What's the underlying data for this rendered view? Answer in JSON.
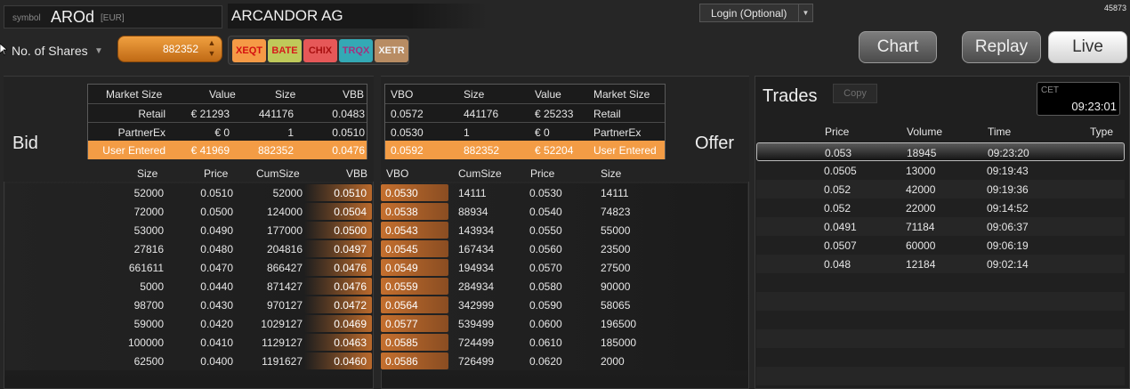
{
  "header": {
    "symbol_prefix": "symbol",
    "symbol": "AROd",
    "currency": "[EUR]",
    "company": "ARCANDOR AG",
    "login": "Login (Optional)",
    "build": "45873"
  },
  "controls": {
    "shares_label": "No. of Shares",
    "shares_value": "882352",
    "exchanges": [
      "XEQT",
      "BATE",
      "CHIX",
      "TRQX",
      "XETR"
    ],
    "chart": "Chart",
    "replay": "Replay",
    "live": "Live"
  },
  "bid": {
    "label": "Bid",
    "summary_headers": [
      "Market Size",
      "Value",
      "Size",
      "VBB"
    ],
    "summary": [
      {
        "market": "Retail",
        "value": "€ 21293",
        "size": "441176",
        "vbb": "0.0483"
      },
      {
        "market": "PartnerEx",
        "value": "€ 0",
        "size": "1",
        "vbb": "0.0510"
      },
      {
        "market": "User Entered",
        "value": "€ 41969",
        "size": "882352",
        "vbb": "0.0476"
      }
    ],
    "headers": [
      "Size",
      "Price",
      "CumSize",
      "VBB"
    ],
    "rows": [
      [
        "52000",
        "0.0510",
        "52000",
        "0.0510"
      ],
      [
        "72000",
        "0.0500",
        "124000",
        "0.0504"
      ],
      [
        "53000",
        "0.0490",
        "177000",
        "0.0500"
      ],
      [
        "27816",
        "0.0480",
        "204816",
        "0.0497"
      ],
      [
        "661611",
        "0.0470",
        "866427",
        "0.0476"
      ],
      [
        "5000",
        "0.0440",
        "871427",
        "0.0476"
      ],
      [
        "98700",
        "0.0430",
        "970127",
        "0.0472"
      ],
      [
        "59000",
        "0.0420",
        "1029127",
        "0.0469"
      ],
      [
        "100000",
        "0.0410",
        "1129127",
        "0.0463"
      ],
      [
        "62500",
        "0.0400",
        "1191627",
        "0.0460"
      ]
    ]
  },
  "offer": {
    "label": "Offer",
    "summary_headers": [
      "VBO",
      "Size",
      "Value",
      "Market Size"
    ],
    "summary": [
      {
        "vbo": "0.0572",
        "size": "441176",
        "value": "€ 25233",
        "market": "Retail"
      },
      {
        "vbo": "0.0530",
        "size": "1",
        "value": "€ 0",
        "market": "PartnerEx"
      },
      {
        "vbo": "0.0592",
        "size": "882352",
        "value": "€ 52204",
        "market": "User Entered"
      }
    ],
    "headers": [
      "VBO",
      "CumSize",
      "Price",
      "Size"
    ],
    "rows": [
      [
        "0.0530",
        "14111",
        "0.0530",
        "14111"
      ],
      [
        "0.0538",
        "88934",
        "0.0540",
        "74823"
      ],
      [
        "0.0543",
        "143934",
        "0.0550",
        "55000"
      ],
      [
        "0.0545",
        "167434",
        "0.0560",
        "23500"
      ],
      [
        "0.0549",
        "194934",
        "0.0570",
        "27500"
      ],
      [
        "0.0559",
        "284934",
        "0.0580",
        "90000"
      ],
      [
        "0.0564",
        "342999",
        "0.0590",
        "58065"
      ],
      [
        "0.0577",
        "539499",
        "0.0600",
        "196500"
      ],
      [
        "0.0585",
        "724499",
        "0.0610",
        "185000"
      ],
      [
        "0.0586",
        "726499",
        "0.0620",
        "2000"
      ]
    ]
  },
  "trades": {
    "title": "Trades",
    "copy": "Copy",
    "clock_zone": "CET",
    "clock_time": "09:23:01",
    "headers": [
      "Price",
      "Volume",
      "Time",
      "Type"
    ],
    "rows": [
      [
        "0.053",
        "18945",
        "09:23:20"
      ],
      [
        "0.0505",
        "13000",
        "09:19:43"
      ],
      [
        "0.052",
        "42000",
        "09:19:36"
      ],
      [
        "0.052",
        "22000",
        "09:14:52"
      ],
      [
        "0.0491",
        "71184",
        "09:06:37"
      ],
      [
        "0.0507",
        "60000",
        "09:06:19"
      ],
      [
        "0.048",
        "12184",
        "09:02:14"
      ]
    ]
  },
  "colors": {
    "accent_orange": "#f39c45",
    "bid_cell_fill": "#1e1e1e",
    "offer_vbo_fill": "#c46f2e"
  }
}
